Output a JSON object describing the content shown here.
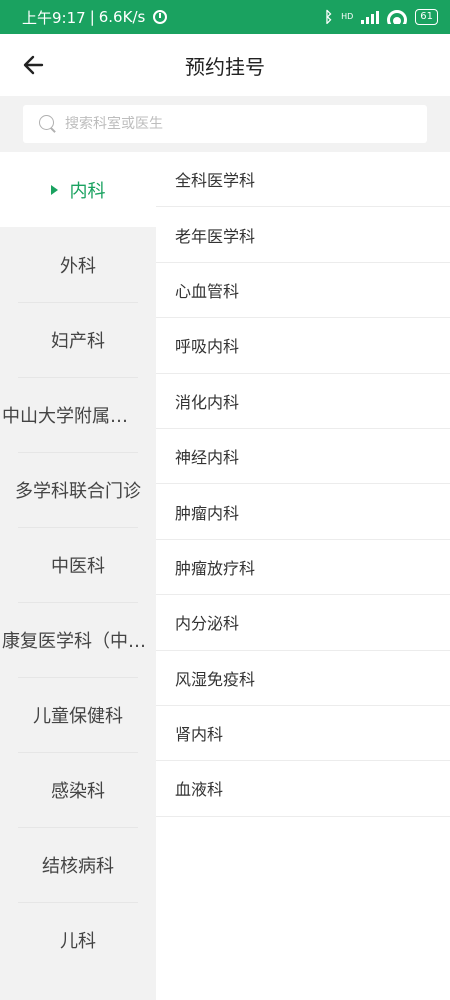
{
  "status_bar": {
    "time": "上午9:17",
    "speed": "6.6K/s",
    "network_label": "HD",
    "battery": "61"
  },
  "header": {
    "title": "预约挂号"
  },
  "search": {
    "placeholder": "搜索科室或医生"
  },
  "sidebar": {
    "items": [
      {
        "label": "内科"
      },
      {
        "label": "外科"
      },
      {
        "label": "妇产科"
      },
      {
        "label": "中山大学附属…"
      },
      {
        "label": "多学科联合门诊"
      },
      {
        "label": "中医科"
      },
      {
        "label": "康复医学科（中…"
      },
      {
        "label": "儿童保健科"
      },
      {
        "label": "感染科"
      },
      {
        "label": "结核病科"
      },
      {
        "label": "儿科"
      }
    ]
  },
  "departments": {
    "items": [
      {
        "label": "全科医学科"
      },
      {
        "label": "老年医学科"
      },
      {
        "label": "心血管科"
      },
      {
        "label": "呼吸内科"
      },
      {
        "label": "消化内科"
      },
      {
        "label": "神经内科"
      },
      {
        "label": "肿瘤内科"
      },
      {
        "label": "肿瘤放疗科"
      },
      {
        "label": "内分泌科"
      },
      {
        "label": "风湿免疫科"
      },
      {
        "label": "肾内科"
      },
      {
        "label": "血液科"
      }
    ]
  },
  "colors": {
    "accent": "#1aa260",
    "sidebar_bg": "#f2f2f2"
  }
}
